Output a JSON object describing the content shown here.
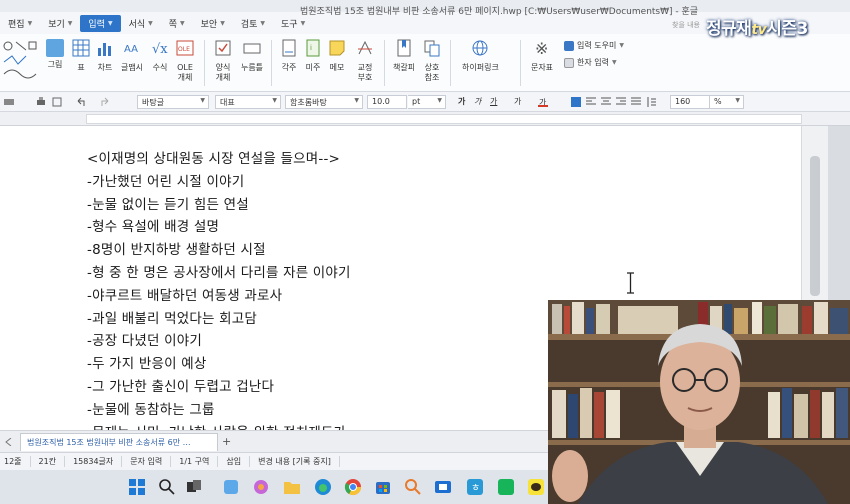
{
  "window": {
    "title": "법원조직법 15조 법원내부 비판 소송서류 6만 페이지.hwp [C:₩Users₩user₩Documents₩] - 훈글",
    "controls": [
      "✥",
      "—",
      "▢",
      "✕"
    ]
  },
  "menu": [
    {
      "label": "편집",
      "active": false
    },
    {
      "label": "보기",
      "active": false
    },
    {
      "label": "입력",
      "active": true
    },
    {
      "label": "서식",
      "active": false
    },
    {
      "label": "쪽",
      "active": false
    },
    {
      "label": "보안",
      "active": false
    },
    {
      "label": "검토",
      "active": false
    },
    {
      "label": "도구",
      "active": false
    }
  ],
  "ribbon": {
    "picture": "그림",
    "table": "표",
    "chart": "차트",
    "glyph": "글맵시",
    "formula": "수식",
    "ole": "OLE",
    "ole2": "개체",
    "form": "양식",
    "form2": "개체",
    "button": "누름틀",
    "footnote": "각주",
    "endnote": "미주",
    "memo": "메모",
    "revision": "교정",
    "revision2": "부호",
    "bookmark": "책갈피",
    "crossref": "상호",
    "crossref2": "참조",
    "hyperlink": "하이퍼링크",
    "symbol": "문자표",
    "input_helper": "입력 도우미",
    "hanja": "한자 입력"
  },
  "format_toolbar": {
    "style_font_lang": "바탕글",
    "style_name": "대표",
    "font_name": "함초롬바탕",
    "font_size": "10.0",
    "font_unit": "pt",
    "zoom": "160",
    "zoom_unit": "%",
    "char_buttons": [
      "가",
      "가",
      "가",
      "가"
    ]
  },
  "document": {
    "lines": [
      "<이재명의 상대원동 시장 연설을 들으며-->",
      "-가난했던 어린 시절 이야기",
      "-눈물 없이는 듣기 힘든 연설",
      "-형수 욕설에 배경 설명",
      "-8명이 반지하방 생활하던 시절",
      "-형 중 한 명은 공사장에서 다리를 자른 이야기",
      "-야쿠르트 배달하던 여동생 과로사",
      "-과일 배불리 먹었다는 회고담",
      "-공장 다녔던 이야기",
      "-두 가지 반응이 예상",
      " -그 가난한 출신이 두렵고 겁난다",
      " -눈물에 동참하는 그룹",
      "-문제는 서민, 가난한 사람을 위한 정치제도가"
    ]
  },
  "tabs": {
    "doc_tab": "법원조직법 15조 법원내부 비판 소송서류 6만 …",
    "add": "+"
  },
  "status": {
    "page": "1/1쪽",
    "section": "1단",
    "line": "12줄",
    "col": "21칸",
    "chars": "15834글자",
    "mode": "문자 입력",
    "area": "1/1 구역",
    "insert": "삽입",
    "track": "변경 내용 [기록 중지]"
  },
  "overlay": {
    "channel_main": "정규재",
    "channel_tv": "tv",
    "channel_season": "시즌3",
    "ribbon_hint": "찾을 내용"
  },
  "colors": {
    "accent": "#2e74c9",
    "page_bg": "#ffffff",
    "spell_underline": "#d4a43a"
  }
}
